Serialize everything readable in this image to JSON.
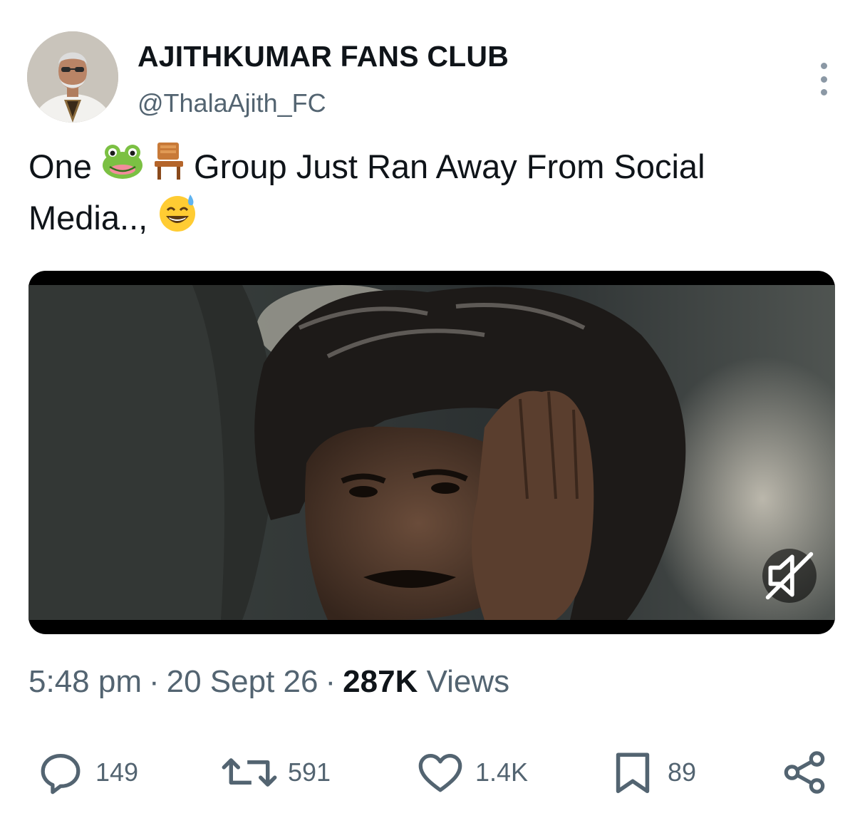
{
  "author": {
    "display_name": "AJITHKUMAR FANS CLUB",
    "handle": "@ThalaAjith_FC",
    "avatar_icon": "profile-photo"
  },
  "tweet": {
    "text_part1": "One",
    "emoji1": "frog-face-emoji",
    "emoji2": "chair-emoji",
    "text_part2": "Group Just Ran Away From Social Media..,",
    "emoji3": "grinning-face-with-sweat-emoji"
  },
  "media": {
    "type": "video",
    "mute_icon": "muted-speaker-icon"
  },
  "meta": {
    "time": "5:48 pm",
    "separator": "·",
    "date": "20 Sept 26",
    "views_count": "287K",
    "views_label": "Views"
  },
  "actions": {
    "replies": "149",
    "reposts": "591",
    "likes": "1.4K",
    "bookmarks": "89",
    "reply_icon": "reply-icon",
    "repost_icon": "repost-icon",
    "like_icon": "heart-icon",
    "bookmark_icon": "bookmark-icon",
    "share_icon": "share-icon"
  },
  "colors": {
    "text_primary": "#0f1419",
    "text_secondary": "#536471"
  }
}
